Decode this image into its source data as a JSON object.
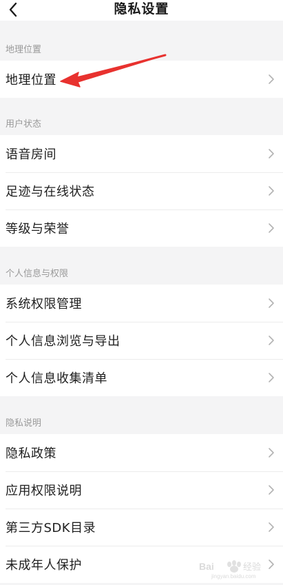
{
  "header": {
    "title": "隐私设置",
    "back_icon": "chevron-left-icon"
  },
  "sections": [
    {
      "header": "地理位置",
      "items": [
        {
          "label": "地理位置"
        }
      ]
    },
    {
      "header": "用户状态",
      "items": [
        {
          "label": "语音房间"
        },
        {
          "label": "足迹与在线状态"
        },
        {
          "label": "等级与荣誉"
        }
      ]
    },
    {
      "header": "个人信息与权限",
      "items": [
        {
          "label": "系统权限管理"
        },
        {
          "label": "个人信息浏览与导出"
        },
        {
          "label": "个人信息收集清单"
        }
      ]
    },
    {
      "header": "隐私说明",
      "items": [
        {
          "label": "隐私政策"
        },
        {
          "label": "应用权限说明"
        },
        {
          "label": "第三方SDK目录"
        },
        {
          "label": "未成年人保护"
        }
      ]
    }
  ],
  "row_icon": "chevron-right-icon",
  "annotation": {
    "type": "red-arrow",
    "color": "#e8322f"
  },
  "watermark": {
    "text": "Baidu 经验",
    "subtext": "jingyan.baidu.com"
  },
  "colors": {
    "background": "#f4f4f5",
    "row_background": "#ffffff",
    "section_text": "#999999",
    "chevron": "#b3b3b3",
    "arrow": "#e8322f"
  }
}
